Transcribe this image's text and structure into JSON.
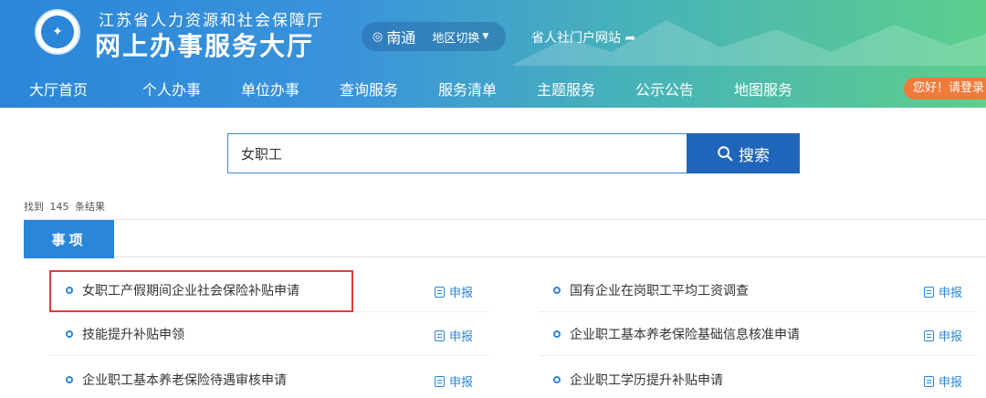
{
  "header": {
    "org_name": "江苏省人力资源和社会保障厅",
    "hall_name": "网上办事服务大厅",
    "region": "南通",
    "region_switch": "地区切换",
    "portal_link": "省人社门户网站",
    "login": "您好！请登录"
  },
  "nav": [
    {
      "label": "大厅首页"
    },
    {
      "label": "个人办事"
    },
    {
      "label": "单位办事"
    },
    {
      "label": "查询服务"
    },
    {
      "label": "服务清单"
    },
    {
      "label": "主题服务"
    },
    {
      "label": "公示公告"
    },
    {
      "label": "地图服务"
    }
  ],
  "search": {
    "value": "女职工",
    "button": "搜索"
  },
  "results": {
    "prefix": "找到",
    "count": "145",
    "suffix": "条结果"
  },
  "tab": "事项",
  "items_left": [
    {
      "title": "女职工产假期间企业社会保险补贴申请",
      "action": "申报"
    },
    {
      "title": "技能提升补贴申领",
      "action": "申报"
    },
    {
      "title": "企业职工基本养老保险待遇审核申请",
      "action": "申报"
    }
  ],
  "items_right": [
    {
      "title": "国有企业在岗职工平均工资调查",
      "action": "申报"
    },
    {
      "title": "企业职工基本养老保险基础信息核准申请",
      "action": "申报"
    },
    {
      "title": "企业职工学历提升补贴申请",
      "action": "申报"
    }
  ],
  "colors": {
    "primary": "#2a86d8",
    "search_button": "#1f66ba",
    "login_button": "#f07a3a",
    "highlight": "#e23b3b"
  }
}
